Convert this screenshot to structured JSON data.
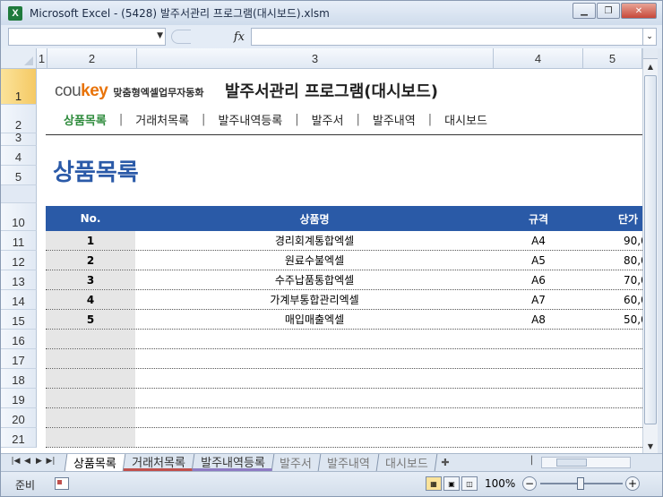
{
  "window": {
    "title": "Microsoft Excel - (5428) 발주서관리 프로그램(대시보드).xlsm",
    "app_icon": "X"
  },
  "formula_bar": {
    "name_box": "",
    "fx_label": "fx",
    "formula": ""
  },
  "columns": [
    "1",
    "2",
    "3",
    "4",
    "5"
  ],
  "rows": [
    "1",
    "2",
    "3",
    "4",
    "5",
    "10",
    "11",
    "12",
    "13",
    "14",
    "15",
    "16",
    "17",
    "18",
    "19",
    "20",
    "21"
  ],
  "header": {
    "logo_cou": "cou",
    "logo_key": "key",
    "logo_tagline": "맞춤형엑셀업무자동화",
    "app_title": "발주서관리 프로그램(대시보드)"
  },
  "nav": {
    "items": [
      "상품목록",
      "거래처목록",
      "발주내역등록",
      "발주서",
      "발주내역",
      "대시보드"
    ],
    "active": "상품목록",
    "separator": "|"
  },
  "page_title": "상품목록",
  "table": {
    "columns": [
      "No.",
      "상품명",
      "규격",
      "단가"
    ],
    "rows": [
      {
        "no": "1",
        "name": "경리회계통합엑셀",
        "spec": "A4",
        "price": "90,0"
      },
      {
        "no": "2",
        "name": "원료수불엑셀",
        "spec": "A5",
        "price": "80,0"
      },
      {
        "no": "3",
        "name": "수주납품통합엑셀",
        "spec": "A6",
        "price": "70,0"
      },
      {
        "no": "4",
        "name": "가계부통합관리엑셀",
        "spec": "A7",
        "price": "60,0"
      },
      {
        "no": "5",
        "name": "매입매출엑셀",
        "spec": "A8",
        "price": "50,0"
      }
    ]
  },
  "sheet_tabs": [
    "상품목록",
    "거래처목록",
    "발주내역등록",
    "발주서",
    "발주내역",
    "대시보드"
  ],
  "status": {
    "ready": "준비",
    "zoom": "100%"
  },
  "colors": {
    "accent_blue": "#2a5aa7",
    "title_blue": "#2b5aa8",
    "nav_active_green": "#2e8b3c",
    "logo_orange": "#e8730a"
  }
}
